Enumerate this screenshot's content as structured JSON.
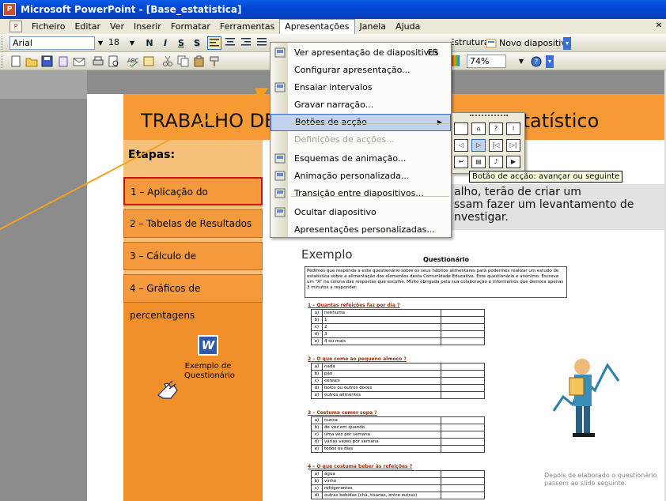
{
  "window": {
    "title": "Microsoft PowerPoint - [Base_estatistica]"
  },
  "menubar": {
    "items": [
      "Ficheiro",
      "Editar",
      "Ver",
      "Inserir",
      "Formatar",
      "Ferramentas",
      "Apresentações",
      "Janela",
      "Ajuda"
    ],
    "active": "Apresentações"
  },
  "toolbar": {
    "font": "Arial",
    "size": "18",
    "bold": "N",
    "italic": "I",
    "underline": "S",
    "shadow": "S",
    "zoom": "74%",
    "design_label": "Estruturar",
    "new_slide_label": "Novo diapositivo"
  },
  "menu": {
    "items": [
      {
        "label": "Ver apresentação de diapositivos",
        "shortcut": "F5",
        "icon": "slideshow-icon"
      },
      {
        "label": "Configurar apresentação...",
        "icon": ""
      },
      {
        "label": "Ensaiar intervalos",
        "icon": "timer-icon"
      },
      {
        "label": "Gravar narração...",
        "icon": ""
      },
      {
        "label": "Botões de acção",
        "icon": "",
        "submenu": true,
        "highlighted": true
      },
      {
        "label": "Definições de acções...",
        "icon": "",
        "disabled": true
      },
      {
        "label": "Esquemas de animação...",
        "icon": "animation-scheme-icon"
      },
      {
        "label": "Animação personalizada...",
        "icon": "custom-animation-icon"
      },
      {
        "label": "Transição entre diapositivos...",
        "icon": "transition-icon"
      },
      {
        "label": "Ocultar diapositivo",
        "icon": "hide-slide-icon"
      },
      {
        "label": "Apresentações personalizadas...",
        "icon": ""
      }
    ]
  },
  "submenu": {
    "buttons": [
      "blank-button",
      "home-button",
      "help-button",
      "info-button",
      "back-button",
      "next-button",
      "beginning-button",
      "end-button",
      "return-button",
      "document-button",
      "sound-button",
      "movie-button"
    ],
    "highlighted": "next-button"
  },
  "tooltip": "Botão de acção: avançar ou seguinte",
  "slide": {
    "title_left": "TRABALHO DE",
    "title_right": "nto Estatístico",
    "etapas": "Etapas:",
    "steps": [
      "1 – Aplicação do questionário",
      "2 – Tabelas de Resultados",
      "3 – Cálculo de percentagens",
      "4 – Gráficos de percentagens"
    ],
    "word_label": "Exemplo de Questionário",
    "body_lines": [
      "alho, terão de criar um",
      "ssam fazer um levantamento de",
      "nvestigar."
    ],
    "exemplo": "Exemplo",
    "bottom_note": "Depois de elaborado o questionário passem ao slide seguinte."
  },
  "questionnaire": {
    "title": "Questionário",
    "intro": "Pedimos que responda a este questionário sobre os seus hábitos alimentares para podermos realizar um estudo de estatística sobre a alimentação dos elementos desta Comunidade Educativa. Este questionário é anónimo. Escreva um \"X\" na coluna das respostas que escolhe. Muito obrigada pela sua colaboração e informamos que demora apenas 3 minutos a responder.",
    "questions": [
      {
        "q": "1 – Quantas refeições faz por dia ?",
        "options": [
          [
            "a)",
            "nenhuma"
          ],
          [
            "b)",
            "1"
          ],
          [
            "c)",
            "2"
          ],
          [
            "d)",
            "3"
          ],
          [
            "e)",
            "4 ou mais"
          ]
        ]
      },
      {
        "q": "2 – O que come ao pequeno almoço ?",
        "options": [
          [
            "a)",
            "nada"
          ],
          [
            "b)",
            "pão"
          ],
          [
            "c)",
            "cereais"
          ],
          [
            "d)",
            "bolos ou outros doces"
          ],
          [
            "e)",
            "outros alimentos"
          ]
        ]
      },
      {
        "q": "3 – Costuma comer sopa ?",
        "options": [
          [
            "a)",
            "nunca"
          ],
          [
            "b)",
            "de vez em quando"
          ],
          [
            "c)",
            "uma vez por semana"
          ],
          [
            "d)",
            "várias vezes por semana"
          ],
          [
            "e)",
            "todos os dias"
          ]
        ]
      },
      {
        "q": "4 – O que costuma beber às refeições ?",
        "options": [
          [
            "a)",
            "água"
          ],
          [
            "b)",
            "vinho"
          ],
          [
            "c)",
            "refrigerantes"
          ],
          [
            "d)",
            "outras bebidas (chá, tisanas, entre outras)"
          ]
        ]
      }
    ]
  }
}
